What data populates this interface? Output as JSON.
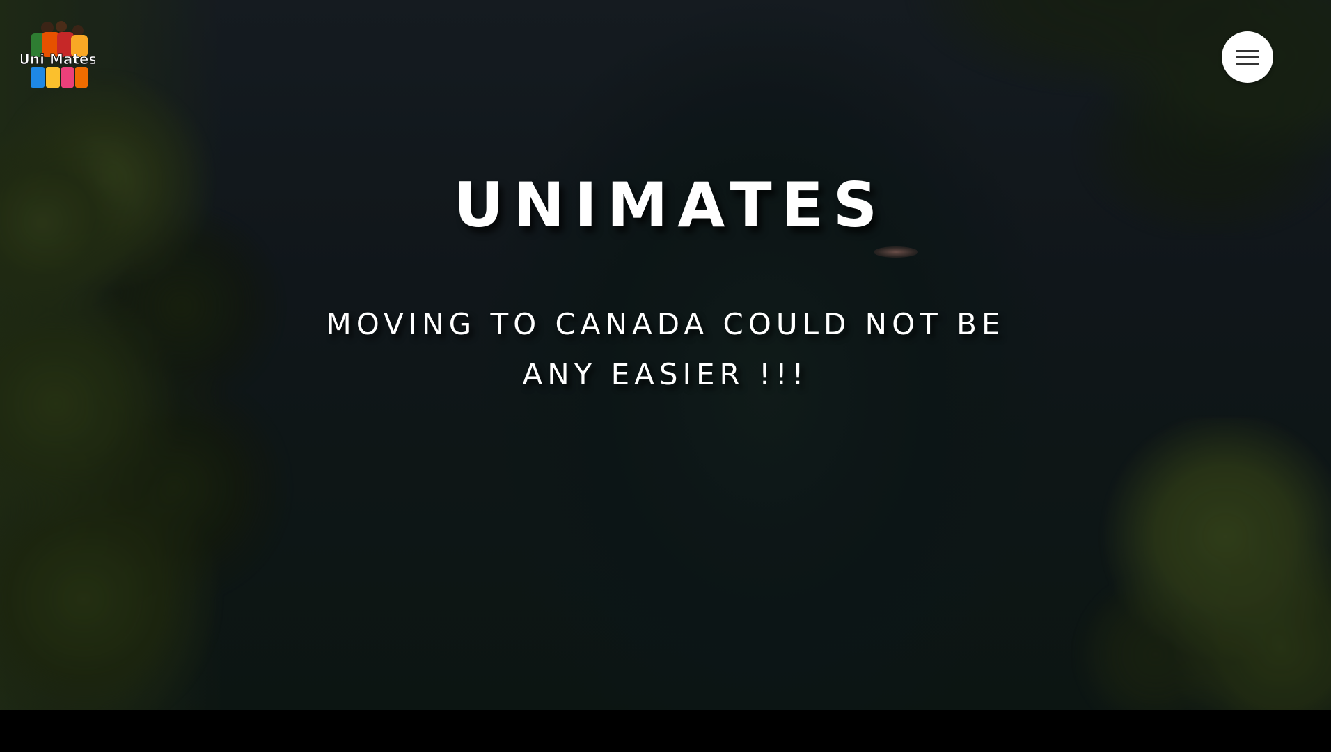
{
  "header": {
    "logo_text": "Uni Mates",
    "menu_icon": "hamburger-menu-icon"
  },
  "hero": {
    "title": "UNIMATES",
    "tagline": "MOVING TO CANADA COULD NOT BE ANY EASIER !!!"
  },
  "colors": {
    "text": "#ffffff",
    "menu_button_bg": "#ffffff",
    "menu_icon": "#333333",
    "footer": "#000000"
  }
}
